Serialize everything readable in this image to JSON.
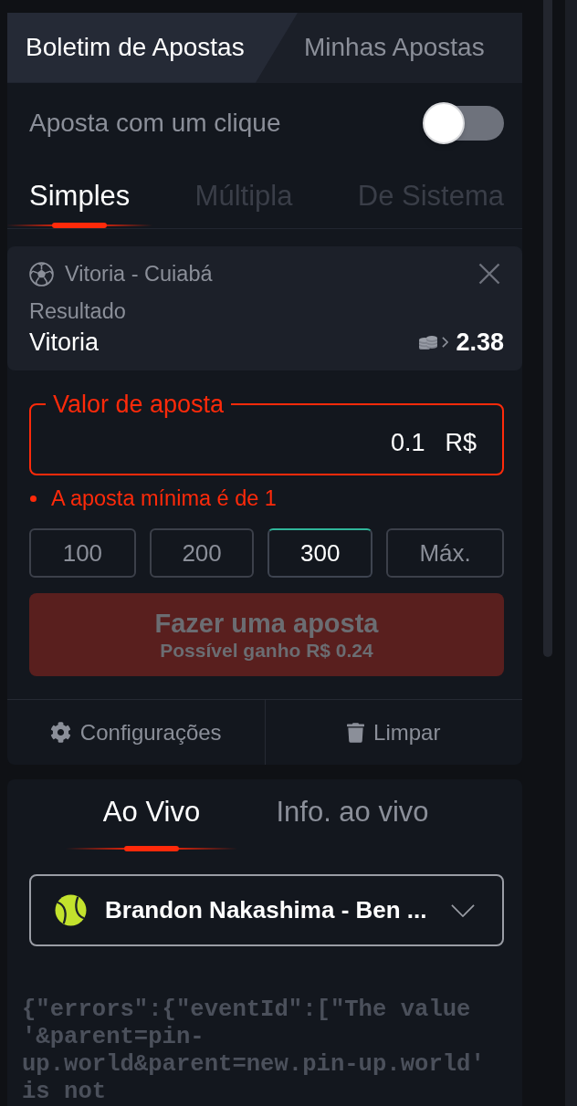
{
  "bet_slip_tabs": [
    {
      "label": "Boletim de Apostas",
      "selected": true
    },
    {
      "label": "Minhas Apostas",
      "selected": false
    }
  ],
  "one_click": {
    "label": "Aposta com um clique",
    "on": false
  },
  "bet_types": [
    {
      "label": "Simples",
      "selected": true
    },
    {
      "label": "Múltipla",
      "selected": false
    },
    {
      "label": "De Sistema",
      "selected": false
    }
  ],
  "selection": {
    "event": "Vitoria - Cuiabá",
    "market": "Resultado",
    "outcome": "Vitoria",
    "odds": "2.38"
  },
  "stake": {
    "label": "Valor de aposta",
    "value": "0.1",
    "currency": "R$",
    "error": "A aposta mínima é de 1"
  },
  "quick_amounts": [
    {
      "label": "100",
      "selected": false
    },
    {
      "label": "200",
      "selected": false
    },
    {
      "label": "300",
      "selected": true
    },
    {
      "label": "Máx.",
      "selected": false
    }
  ],
  "place_bet": {
    "label": "Fazer uma aposta",
    "subtitle": "Possível ganho R$ 0.24",
    "disabled": true
  },
  "footer": [
    {
      "kind": "settings",
      "label": "Configurações"
    },
    {
      "kind": "clear",
      "label": "Limpar"
    }
  ],
  "live_tabs": [
    {
      "label": "Ao Vivo",
      "selected": true
    },
    {
      "label": "Info. ao vivo",
      "selected": false
    }
  ],
  "live_event": {
    "label": "Brandon Nakashima - Ben ..."
  },
  "error_output": "{\"errors\":{\"eventId\":[\"The value '&parent=pin-up.world&parent=new.pin-up.world' is not"
}
